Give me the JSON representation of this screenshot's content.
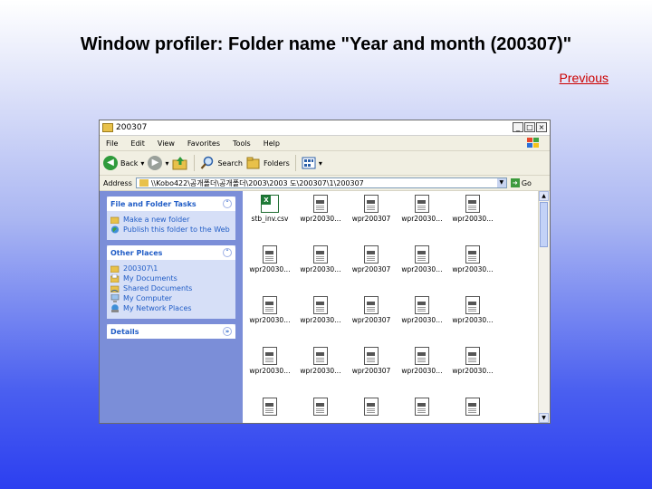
{
  "slide": {
    "title": "Window profiler: Folder name \"Year and month (200307)\"",
    "previous_link": "Previous"
  },
  "window": {
    "title": "200307",
    "buttons": {
      "minimize": "_",
      "maximize": "□",
      "close": "×"
    },
    "menu": [
      "File",
      "Edit",
      "View",
      "Favorites",
      "Tools",
      "Help"
    ],
    "toolbar": {
      "back": "Back",
      "search": "Search",
      "folders": "Folders"
    },
    "address": {
      "label": "Address",
      "path": "\\\\Kobo422\\공개폴더\\공개폴더\\2003\\2003 도\\200307\\1\\200307",
      "go": "Go"
    }
  },
  "tasks_pane": {
    "file_folder_tasks": {
      "title": "File and Folder Tasks",
      "chevron": "˄",
      "items": [
        "Make a new folder",
        "Publish this folder to the Web"
      ]
    },
    "other_places": {
      "title": "Other Places",
      "chevron": "˄",
      "items": [
        "200307\\1",
        "My Documents",
        "Shared Documents",
        "My Computer",
        "My Network Places"
      ]
    },
    "details": {
      "title": "Details",
      "chevron": "»"
    }
  },
  "files": [
    {
      "label": "stb_inv.csv",
      "type": "xls"
    },
    {
      "label": "wpr20030…",
      "type": "doc"
    },
    {
      "label": "wpr200307",
      "type": "doc"
    },
    {
      "label": "wpr20030…",
      "type": "doc"
    },
    {
      "label": "wpr20030…",
      "type": "doc"
    },
    {
      "label": "wpr20030…",
      "type": "doc"
    },
    {
      "label": "wpr20030…",
      "type": "doc"
    },
    {
      "label": "wpr200307",
      "type": "doc"
    },
    {
      "label": "wpr20030…",
      "type": "doc"
    },
    {
      "label": "wpr20030…",
      "type": "doc"
    },
    {
      "label": "wpr20030…",
      "type": "doc"
    },
    {
      "label": "wpr20030…",
      "type": "doc"
    },
    {
      "label": "wpr200307",
      "type": "doc"
    },
    {
      "label": "wpr20030…",
      "type": "doc"
    },
    {
      "label": "wpr20030…",
      "type": "doc"
    },
    {
      "label": "wpr20030…",
      "type": "doc"
    },
    {
      "label": "wpr20030…",
      "type": "doc"
    },
    {
      "label": "wpr200307",
      "type": "doc"
    },
    {
      "label": "wpr20030…",
      "type": "doc"
    },
    {
      "label": "wpr20030…",
      "type": "doc"
    },
    {
      "label": "",
      "type": "doc"
    },
    {
      "label": "",
      "type": "doc"
    },
    {
      "label": "",
      "type": "doc"
    },
    {
      "label": "",
      "type": "doc"
    },
    {
      "label": "",
      "type": "doc"
    }
  ],
  "colors": {
    "task_link": "#215dc6",
    "pane_bg": "#7b8ed8",
    "previous_link": "#cc0000"
  }
}
